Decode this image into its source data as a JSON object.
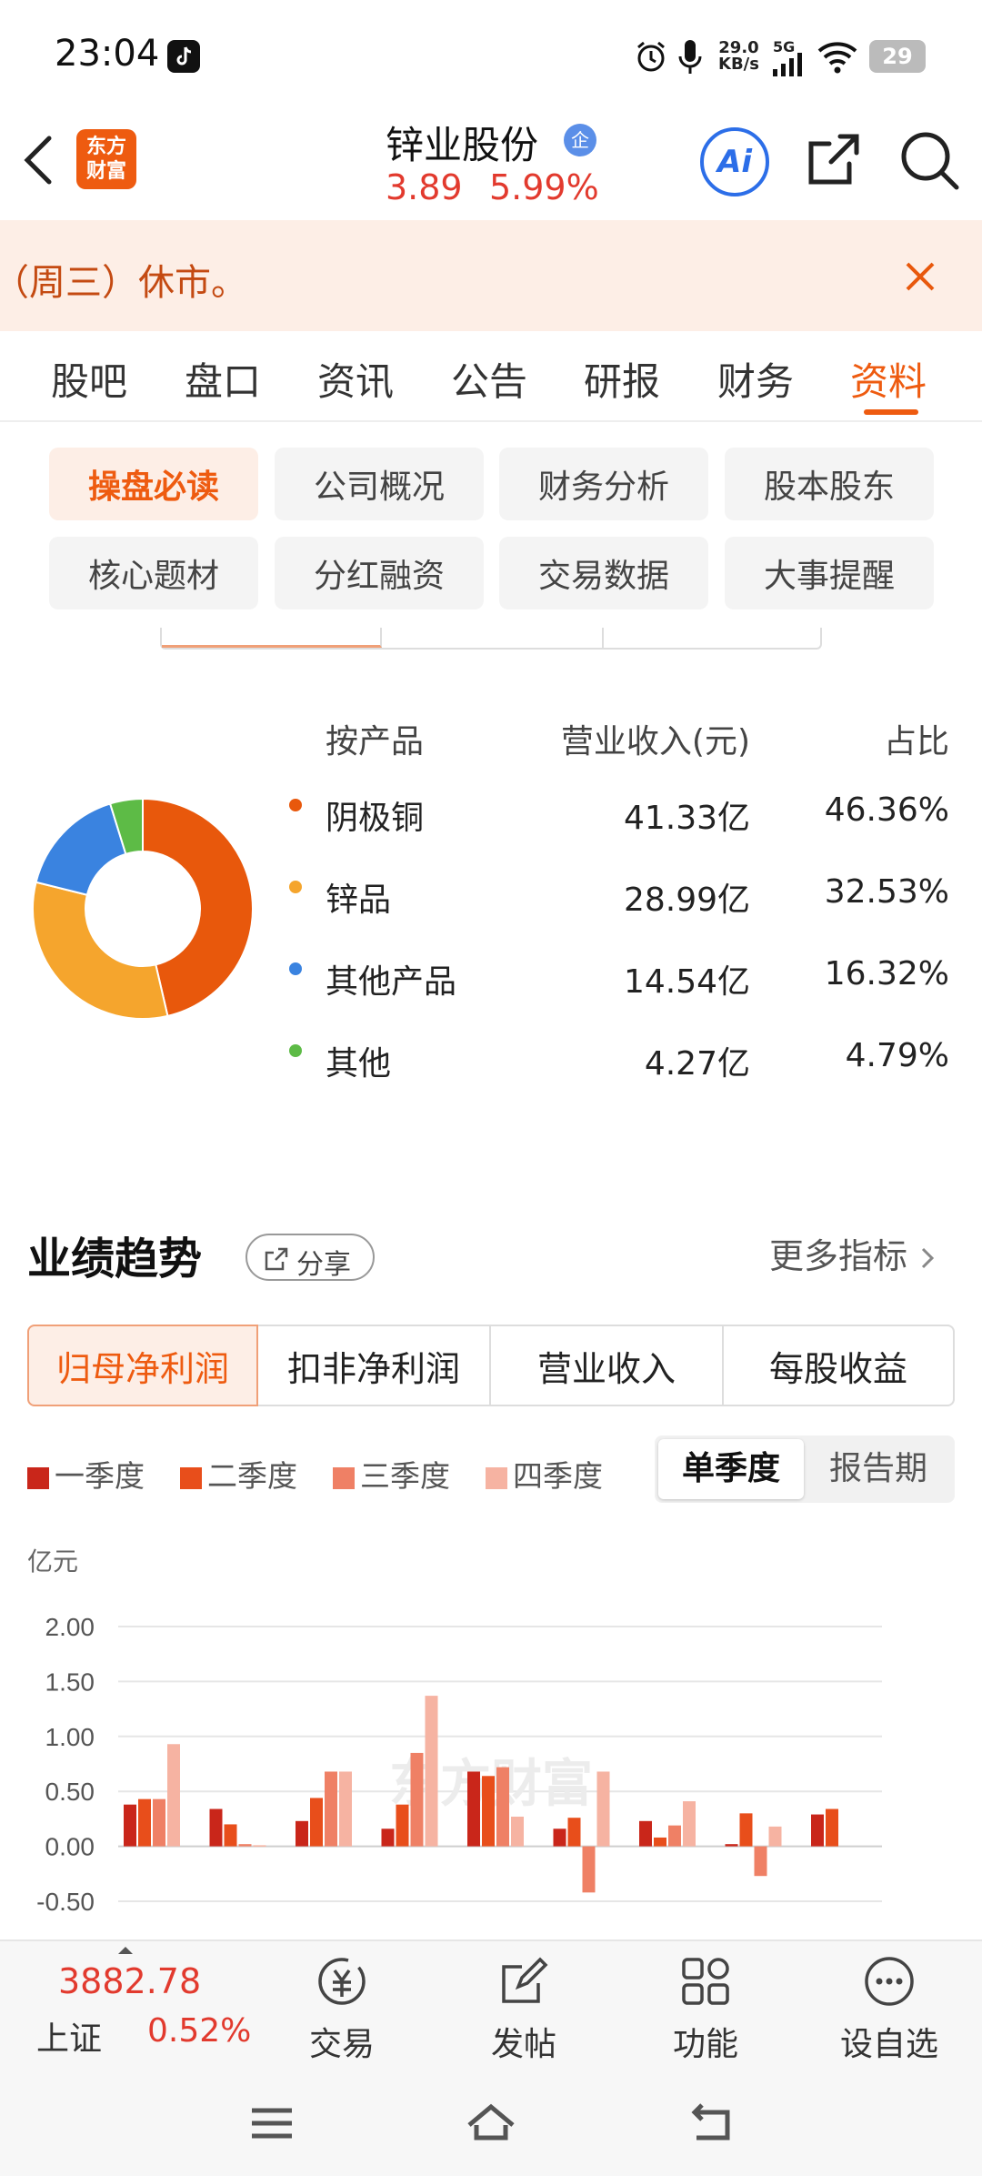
{
  "status_bar": {
    "time": "23:04",
    "net_speed_top": "29.0",
    "net_speed_bottom": "KB/s",
    "network": "5G",
    "battery": "29"
  },
  "header": {
    "brand_line1": "东方",
    "brand_line2": "财富",
    "stock_name": "锌业股份",
    "badge": "企",
    "price": "3.89",
    "change_pct": "5.99%",
    "ai_label": "Ai"
  },
  "notice": {
    "text": "（周三）休市。"
  },
  "tabs": [
    "股吧",
    "盘口",
    "资讯",
    "公告",
    "研报",
    "财务",
    "资料"
  ],
  "active_tab": "资料",
  "chips": [
    "操盘必读",
    "公司概况",
    "财务分析",
    "股本股东",
    "核心题材",
    "分红融资",
    "交易数据",
    "大事提醒"
  ],
  "composition": {
    "headers": [
      "按产品",
      "营业收入(元)",
      "占比"
    ],
    "rows": [
      {
        "name": "阴极铜",
        "revenue": "41.33亿",
        "pct": "46.36%",
        "value": 46.36,
        "color": "#e8580c"
      },
      {
        "name": "锌品",
        "revenue": "28.99亿",
        "pct": "32.53%",
        "value": 32.53,
        "color": "#f5a52d"
      },
      {
        "name": "其他产品",
        "revenue": "14.54亿",
        "pct": "16.32%",
        "value": 16.32,
        "color": "#3a83e0"
      },
      {
        "name": "其他",
        "revenue": "4.27亿",
        "pct": "4.79%",
        "value": 4.79,
        "color": "#5dbb46"
      }
    ]
  },
  "performance": {
    "title": "业绩趋势",
    "share_label": "分享",
    "more_label": "更多指标",
    "metric_tabs": [
      "归母净利润",
      "扣非净利润",
      "营业收入",
      "每股收益"
    ],
    "active_metric": "归母净利润",
    "period_toggle": [
      "单季度",
      "报告期"
    ],
    "active_period": "单季度"
  },
  "chart_data": {
    "type": "bar",
    "ylabel": "亿元",
    "yticks": [
      "2.00",
      "1.50",
      "1.00",
      "0.50",
      "0.00",
      "-0.50"
    ],
    "ylim": [
      -0.5,
      2.0
    ],
    "watermark": "东方财富",
    "series": [
      {
        "name": "一季度",
        "color": "#c9261a",
        "values": [
          0.38,
          0.34,
          0.23,
          0.16,
          0.68,
          0.16,
          0.23,
          0.02,
          0.29
        ]
      },
      {
        "name": "二季度",
        "color": "#e84e1b",
        "values": [
          0.43,
          0.2,
          0.44,
          0.38,
          0.64,
          0.26,
          0.08,
          0.3,
          0.34
        ]
      },
      {
        "name": "三季度",
        "color": "#ef8065",
        "values": [
          0.43,
          0.02,
          0.68,
          0.85,
          0.72,
          -0.42,
          0.19,
          -0.27,
          null
        ]
      },
      {
        "name": "四季度",
        "color": "#f6b3a2",
        "values": [
          0.93,
          0.01,
          0.68,
          1.37,
          0.27,
          0.68,
          0.41,
          0.18,
          null
        ]
      }
    ]
  },
  "bottom_nav": {
    "index_value": "3882.78",
    "index_name": "上证",
    "index_change": "0.52%",
    "items": [
      "交易",
      "发帖",
      "功能",
      "设自选"
    ]
  }
}
